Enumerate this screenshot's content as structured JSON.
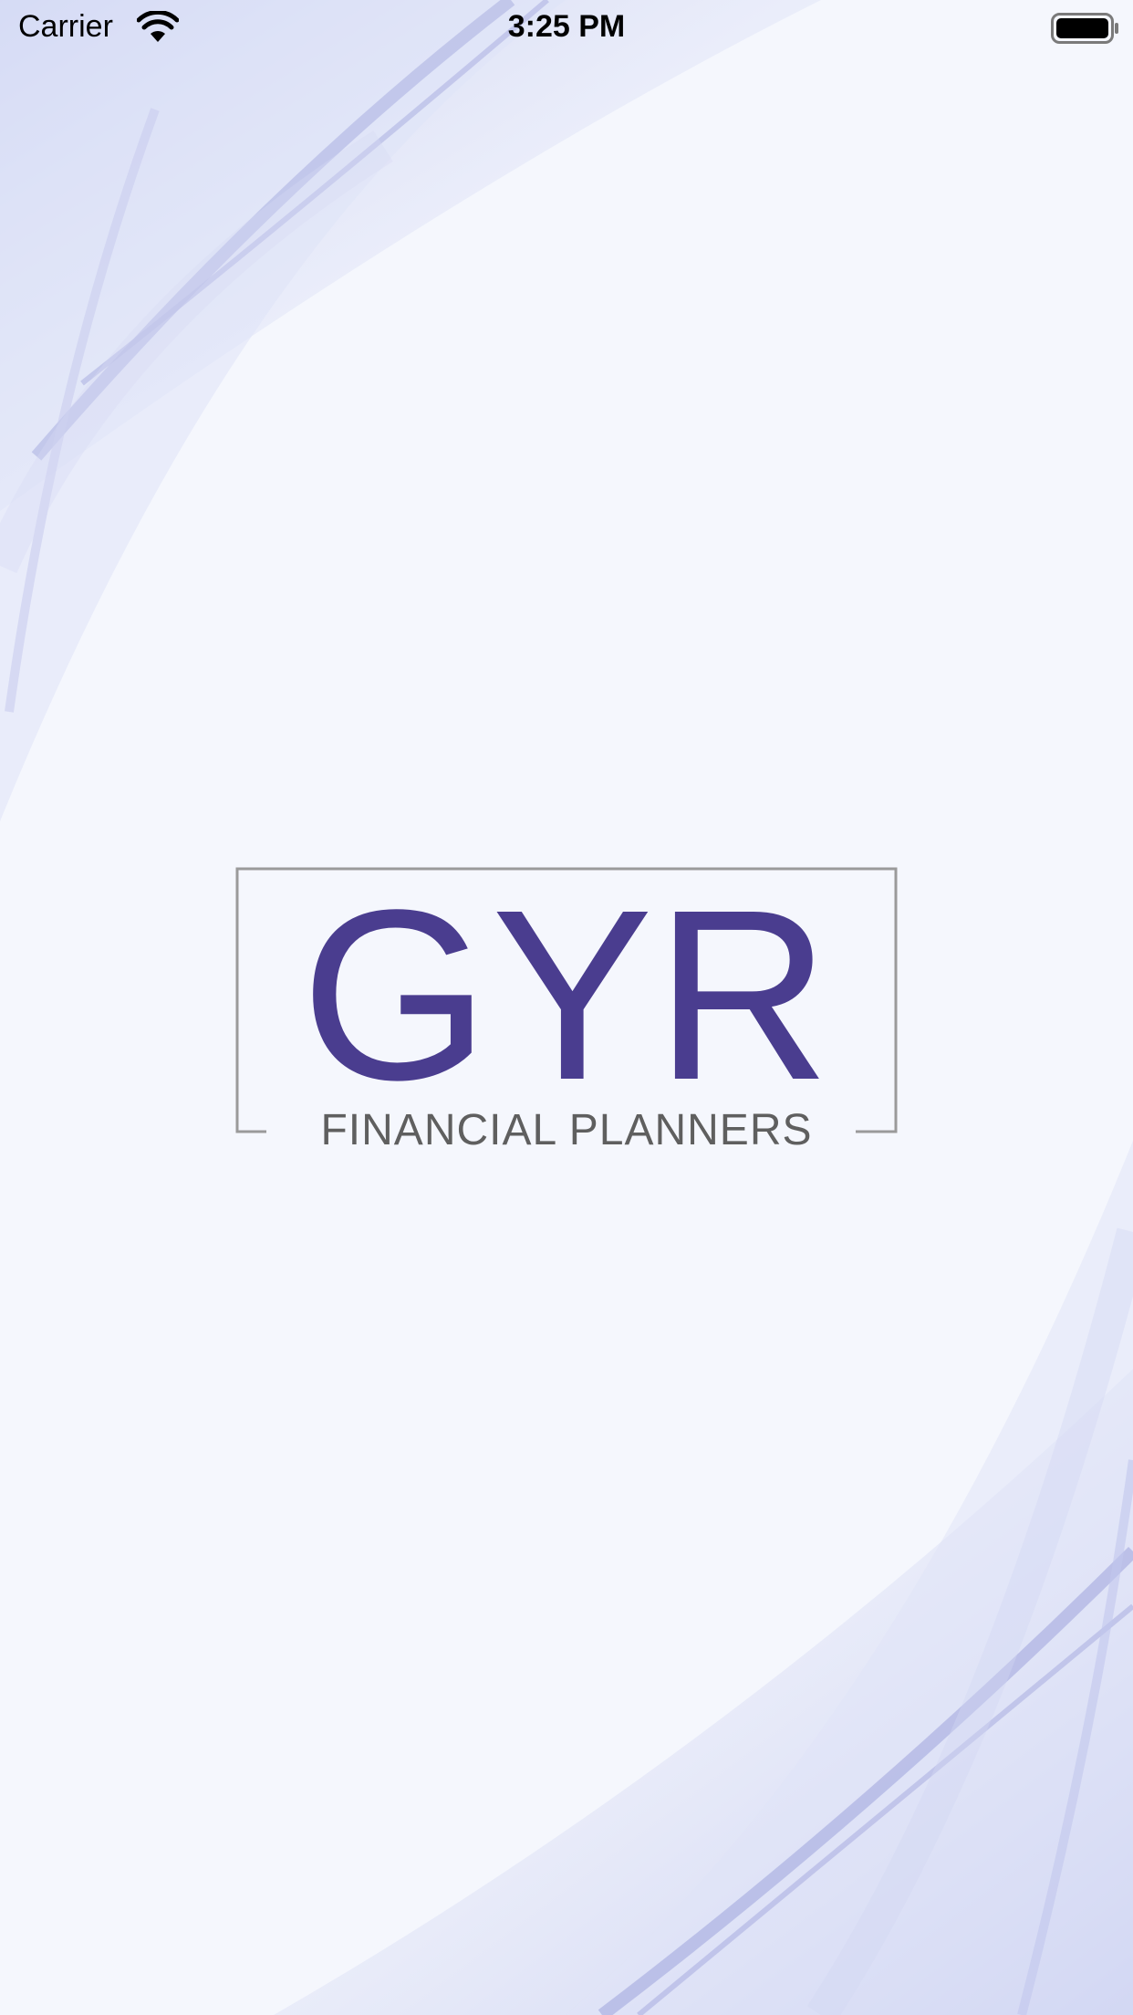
{
  "status_bar": {
    "carrier": "Carrier",
    "time": "3:25 PM",
    "icons": [
      "wifi-icon",
      "battery-icon"
    ]
  },
  "logo": {
    "main_text": "GYR",
    "sub_text": "FINANCIAL PLANNERS"
  },
  "colors": {
    "background": "#f5f7fd",
    "brand_purple": "#4a3d8f",
    "logo_gray": "#5f5f5f",
    "wave_tint": "#b8bfe8"
  }
}
